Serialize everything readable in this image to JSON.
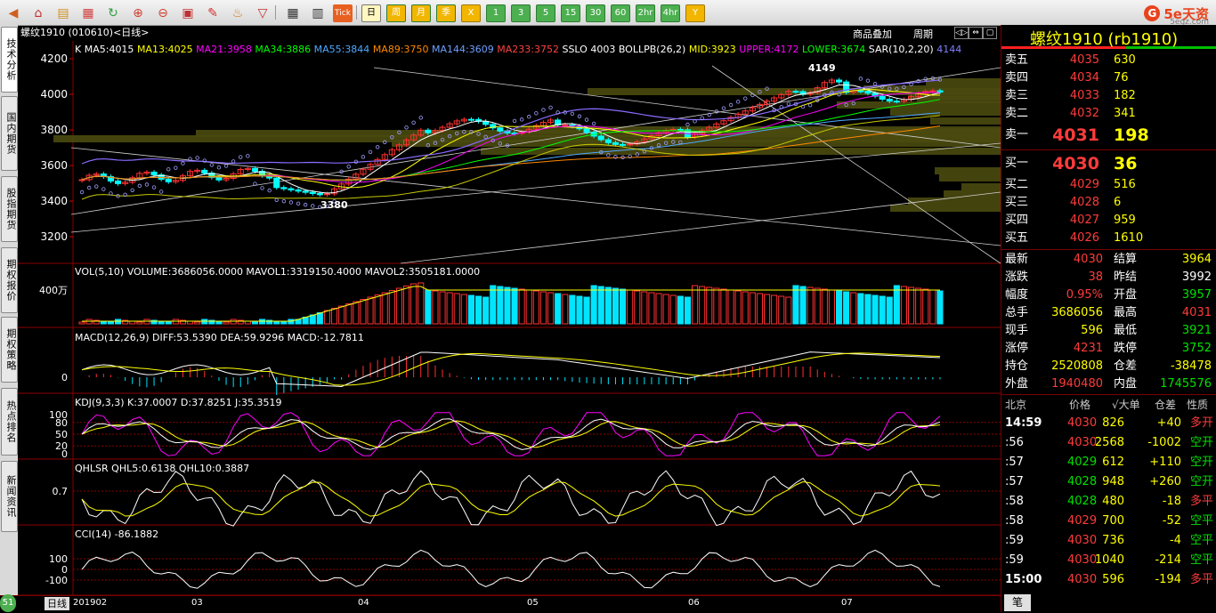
{
  "toolbar": {
    "icons": [
      "back-icon",
      "home-icon",
      "book-icon",
      "f10-icon",
      "refresh-icon",
      "zoom-in-icon",
      "zoom-out-icon",
      "window-icon",
      "pen-icon",
      "alert-icon",
      "filter-icon",
      "report-icon",
      "chart-icon",
      "tick-icon"
    ],
    "tick_label": "Tick",
    "periods": [
      "日",
      "周",
      "月",
      "季",
      "X",
      "1",
      "3",
      "5",
      "15",
      "30",
      "60",
      "2hr",
      "4hr",
      "Y"
    ],
    "selected_period": "日"
  },
  "logo": {
    "mark": "G",
    "name": "5e天资",
    "sub": "5egz.com"
  },
  "sidebar": {
    "tabs": [
      "技术分析",
      "国内期货",
      "股指期货",
      "期权报价",
      "期权策略",
      "热点排名",
      "新闻资讯"
    ]
  },
  "chart": {
    "security": "螺纹1910 (010610)<日线>",
    "main_indicators": [
      {
        "text": "K",
        "color": "#ffffff"
      },
      {
        "text": "MA5:4015",
        "color": "#ffffff"
      },
      {
        "text": "MA13:4025",
        "color": "#ffff00"
      },
      {
        "text": "MA21:3958",
        "color": "#ff00ff"
      },
      {
        "text": "MA34:3886",
        "color": "#00ff00"
      },
      {
        "text": "MA55:3844",
        "color": "#4fa8ff"
      },
      {
        "text": "MA89:3750",
        "color": "#ff8800"
      },
      {
        "text": "MA144:3609",
        "color": "#6fa0ff"
      },
      {
        "text": "MA233:3752",
        "color": "#ff4040"
      },
      {
        "text": "SSLO 4003",
        "color": "#ffffff"
      },
      {
        "text": "BOLLPB(26,2)",
        "color": "#ffffff"
      },
      {
        "text": "MID:3923",
        "color": "#ffff00"
      },
      {
        "text": "UPPER:4172",
        "color": "#ff00ff"
      },
      {
        "text": "LOWER:3674",
        "color": "#00ff00"
      },
      {
        "text": "SAR(10,2,20)",
        "color": "#ffffff"
      },
      {
        "text": "4144",
        "color": "#8080ff"
      }
    ],
    "controls": {
      "overlay": "商品叠加",
      "period": "周期"
    },
    "nav_buttons": [
      "◁▷",
      "⇔",
      "▢"
    ],
    "price_ticks": [
      "4200",
      "4000",
      "3800",
      "3600",
      "3400",
      "3200"
    ],
    "annotations": {
      "high": "4149",
      "low": "3380"
    },
    "vol": {
      "title": "VOL(5,10) VOLUME:3686056.0000 MAVOL1:3319150.4000 MAVOL2:3505181.0000",
      "tick": "400万"
    },
    "macd": {
      "title": "MACD(12,26,9) DIFF:53.5390 DEA:59.9296 MACD:-12.7811",
      "tick": "0"
    },
    "kdj": {
      "title": "KDJ(9,3,3) K:37.0007 D:37.8251 J:35.3519",
      "ticks": [
        "100",
        "80",
        "50",
        "20",
        "0"
      ]
    },
    "qhlsr": {
      "title": "QHLSR QHL5:0.6138 QHL10:0.3887",
      "tick": "0.7"
    },
    "cci": {
      "title": "CCI(14) -86.1882",
      "ticks": [
        "100",
        "0",
        "-100"
      ]
    },
    "x_labels": [
      "201902",
      "03",
      "04",
      "05",
      "06",
      "07"
    ],
    "period_label": "日线",
    "badge": "51"
  },
  "quote": {
    "title": "螺纹1910 (rb1910)",
    "asks": [
      {
        "label": "卖五",
        "price": "4035",
        "vol": "630"
      },
      {
        "label": "卖四",
        "price": "4034",
        "vol": "76"
      },
      {
        "label": "卖三",
        "price": "4033",
        "vol": "182"
      },
      {
        "label": "卖二",
        "price": "4032",
        "vol": "341"
      },
      {
        "label": "卖一",
        "price": "4031",
        "vol": "198"
      }
    ],
    "bids": [
      {
        "label": "买一",
        "price": "4030",
        "vol": "36"
      },
      {
        "label": "买二",
        "price": "4029",
        "vol": "516"
      },
      {
        "label": "买三",
        "price": "4028",
        "vol": "6"
      },
      {
        "label": "买四",
        "price": "4027",
        "vol": "959"
      },
      {
        "label": "买五",
        "price": "4026",
        "vol": "1610"
      }
    ],
    "stats": [
      {
        "l1": "最新",
        "v1": "4030",
        "c1": "red",
        "l2": "结算",
        "v2": "3964",
        "c2": "yel"
      },
      {
        "l1": "涨跌",
        "v1": "38",
        "c1": "red",
        "l2": "昨结",
        "v2": "3992",
        "c2": "white"
      },
      {
        "l1": "幅度",
        "v1": "0.95%",
        "c1": "red",
        "l2": "开盘",
        "v2": "3957",
        "c2": "green"
      },
      {
        "l1": "总手",
        "v1": "3686056",
        "c1": "yel",
        "l2": "最高",
        "v2": "4031",
        "c2": "red"
      },
      {
        "l1": "现手",
        "v1": "596",
        "c1": "yel",
        "l2": "最低",
        "v2": "3921",
        "c2": "green"
      },
      {
        "l1": "涨停",
        "v1": "4231",
        "c1": "red",
        "l2": "跌停",
        "v2": "3752",
        "c2": "green"
      },
      {
        "l1": "持仓",
        "v1": "2520808",
        "c1": "yel",
        "l2": "仓差",
        "v2": "-38478",
        "c2": "yel"
      },
      {
        "l1": "外盘",
        "v1": "1940480",
        "c1": "red",
        "l2": "内盘",
        "v2": "1745576",
        "c2": "green"
      }
    ],
    "trade_header": {
      "city": "北京",
      "price": "价格",
      "vol": "√大单",
      "diff": "仓差",
      "nature": "性质"
    },
    "trades": [
      {
        "time": "14:59",
        "price": "4030",
        "vol": "826",
        "diff": "+40",
        "nature": "多开",
        "pc": "red",
        "nc": "red"
      },
      {
        "time": ":56",
        "price": "4030",
        "vol": "2568",
        "diff": "-1002",
        "nature": "空开",
        "pc": "red",
        "nc": "green"
      },
      {
        "time": ":57",
        "price": "4029",
        "vol": "612",
        "diff": "+110",
        "nature": "空开",
        "pc": "green",
        "nc": "green"
      },
      {
        "time": ":57",
        "price": "4028",
        "vol": "948",
        "diff": "+260",
        "nature": "空开",
        "pc": "green",
        "nc": "green"
      },
      {
        "time": ":58",
        "price": "4028",
        "vol": "480",
        "diff": "-18",
        "nature": "多平",
        "pc": "green",
        "nc": "red"
      },
      {
        "time": ":58",
        "price": "4029",
        "vol": "700",
        "diff": "-52",
        "nature": "空平",
        "pc": "red",
        "nc": "green"
      },
      {
        "time": ":59",
        "price": "4030",
        "vol": "736",
        "diff": "-4",
        "nature": "空平",
        "pc": "red",
        "nc": "green"
      },
      {
        "time": ":59",
        "price": "4030",
        "vol": "1040",
        "diff": "-214",
        "nature": "空平",
        "pc": "red",
        "nc": "green"
      },
      {
        "time": "15:00",
        "price": "4030",
        "vol": "596",
        "diff": "-194",
        "nature": "多平",
        "pc": "red",
        "nc": "red"
      }
    ],
    "bottom_tab": "笔"
  }
}
